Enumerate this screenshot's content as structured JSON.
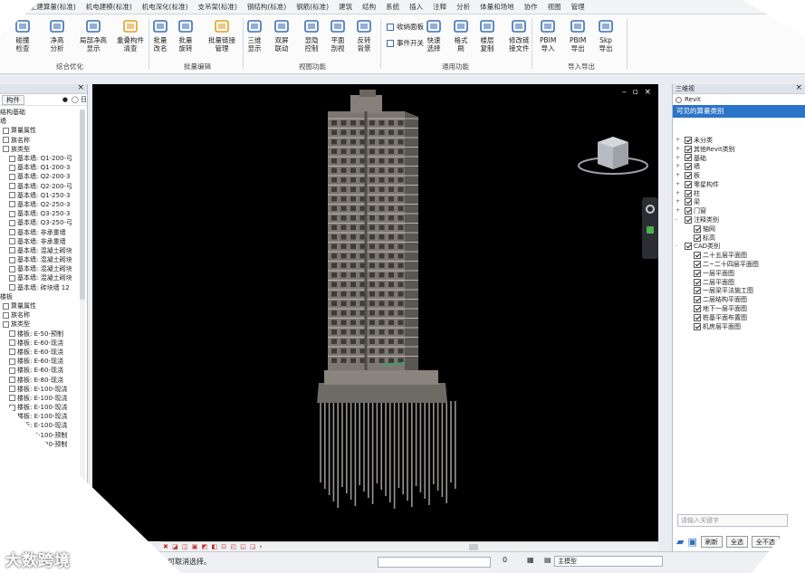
{
  "menu": [
    "结构)",
    "土建算量(标准)",
    "机电建模(标准)",
    "机电深化(标准)",
    "支吊架(标准)",
    "钢结构(标准)",
    "钢筋(标准)",
    "建筑",
    "结构",
    "系统",
    "插入",
    "注释",
    "分析",
    "体量和场地",
    "协作",
    "视图",
    "管理"
  ],
  "ribbon": {
    "b1": {
      "line1": "碰撞",
      "line2": "检查"
    },
    "b2": {
      "line1": "净高",
      "line2": "分析"
    },
    "b3": {
      "line1": "局部净高",
      "line2": "显示"
    },
    "b4": {
      "line1": "重叠构件",
      "line2": "清查"
    },
    "g1": "综合优化",
    "b5": {
      "line1": "批量",
      "line2": "改名"
    },
    "b6": {
      "line1": "批量",
      "line2": "旋转"
    },
    "b7": {
      "line1": "批量链接",
      "line2": "管理"
    },
    "g2": "批量编辑",
    "b8": {
      "line1": "三维",
      "line2": "显示"
    },
    "b9": {
      "line1": "双屏",
      "line2": "联动"
    },
    "b10": {
      "line1": "显隐",
      "line2": "控制"
    },
    "b11": {
      "line1": "平面",
      "line2": "剖视"
    },
    "b12": {
      "line1": "反转",
      "line2": "背景"
    },
    "g3": "视图功能",
    "h1": "收纳面板",
    "h2": "事件开关",
    "b13": {
      "line1": "快速",
      "line2": "选择"
    },
    "b14": {
      "line1": "格式",
      "line2": "刷"
    },
    "b15": {
      "line1": "楼层",
      "line2": "复制"
    },
    "b16": {
      "line1": "修改链",
      "line2": "接文件"
    },
    "g4": "通用功能",
    "b17": {
      "line1": "PBIM",
      "line2": "导入"
    },
    "b18": {
      "line1": "PBIM",
      "line2": "导出"
    },
    "b19": {
      "line1": "Skp",
      "line2": "导出"
    },
    "g5": "导入导出"
  },
  "left_panel": {
    "tab": "构件",
    "radio_on": "●",
    "radio_text": "◯ 日",
    "rows": [
      {
        "t": "结构基础",
        "i": 0,
        "c": false
      },
      {
        "t": "墙",
        "i": 0,
        "c": false
      },
      {
        "t": "算量属性",
        "i": 1,
        "c": true
      },
      {
        "t": "族名称",
        "i": 1,
        "c": true
      },
      {
        "t": "族类型",
        "i": 1,
        "c": true
      },
      {
        "t": "基本墙: Q1-200-弓",
        "i": 2,
        "c": true
      },
      {
        "t": "基本墙: Q1-200-3",
        "i": 2,
        "c": true
      },
      {
        "t": "基本墙: Q2-200-3",
        "i": 2,
        "c": true
      },
      {
        "t": "基本墙: Q2-200-弓",
        "i": 2,
        "c": true
      },
      {
        "t": "基本墙: Q1-250-3",
        "i": 2,
        "c": true
      },
      {
        "t": "基本墙: Q2-250-3",
        "i": 2,
        "c": true
      },
      {
        "t": "基本墙: Q3-250-3",
        "i": 2,
        "c": true
      },
      {
        "t": "基本墙: Q3-250-弓",
        "i": 2,
        "c": true
      },
      {
        "t": "基本墙: 非承重墙",
        "i": 2,
        "c": true
      },
      {
        "t": "基本墙: 非承重墙",
        "i": 2,
        "c": true
      },
      {
        "t": "基本墙: 混凝土砌块",
        "i": 2,
        "c": true
      },
      {
        "t": "基本墙: 混凝土砌块",
        "i": 2,
        "c": true
      },
      {
        "t": "基本墙: 混凝土砌块",
        "i": 2,
        "c": true
      },
      {
        "t": "基本墙: 混凝土砌块",
        "i": 2,
        "c": true
      },
      {
        "t": "基本墙: 砖块墙 12",
        "i": 2,
        "c": true
      },
      {
        "t": "楼板",
        "i": 0,
        "c": false
      },
      {
        "t": "算量属性",
        "i": 1,
        "c": true
      },
      {
        "t": "族名称",
        "i": 1,
        "c": true
      },
      {
        "t": "族类型",
        "i": 1,
        "c": true
      },
      {
        "t": "楼板: E-50-预制",
        "i": 2,
        "c": true
      },
      {
        "t": "楼板: E-60-现浇",
        "i": 2,
        "c": true
      },
      {
        "t": "楼板: E-60-现浇",
        "i": 2,
        "c": true
      },
      {
        "t": "楼板: E-60-现浇",
        "i": 2,
        "c": true
      },
      {
        "t": "楼板: E-60-现浇",
        "i": 2,
        "c": true
      },
      {
        "t": "楼板: E-80-现浇",
        "i": 2,
        "c": true
      },
      {
        "t": "楼板: E-100-现浇",
        "i": 2,
        "c": true
      },
      {
        "t": "楼板: E-100-现浇",
        "i": 2,
        "c": true
      },
      {
        "t": "楼板: E-100-现浇",
        "i": 2,
        "c": true
      },
      {
        "t": "楼板: E-100-现浇",
        "i": 2,
        "c": true
      },
      {
        "t": "楼板: E-100-现浇",
        "i": 2,
        "c": true
      },
      {
        "t": "楼板: E-100-预制",
        "i": 2,
        "c": true
      },
      {
        "t": "楼板: E-100-预制",
        "i": 2,
        "c": true
      }
    ]
  },
  "viewport": {
    "window_controls": "– ▫ ×"
  },
  "bottombar": {
    "arrow": "‹"
  },
  "status": {
    "text": "可取消选择。",
    "coord": "0",
    "label": "主模型",
    "view": "主模型"
  },
  "right_panel": {
    "header": "三维视",
    "radio_label": "Revit",
    "bar": "可见的算量类别",
    "tree": [
      {
        "t": "未分类",
        "l": 0,
        "e": "+"
      },
      {
        "t": "其他Revit类别",
        "l": 0,
        "e": "+"
      },
      {
        "t": "基础",
        "l": 0,
        "e": "+"
      },
      {
        "t": "墙",
        "l": 0,
        "e": "+"
      },
      {
        "t": "板",
        "l": 0,
        "e": "+"
      },
      {
        "t": "零星构件",
        "l": 0,
        "e": "+"
      },
      {
        "t": "柱",
        "l": 0,
        "e": "+"
      },
      {
        "t": "梁",
        "l": 0,
        "e": "+"
      },
      {
        "t": "门窗",
        "l": 0,
        "e": "+"
      },
      {
        "t": "注释类别",
        "l": 0,
        "e": "-"
      },
      {
        "t": "轴网",
        "l": 1,
        "e": ""
      },
      {
        "t": "标高",
        "l": 1,
        "e": ""
      },
      {
        "t": "CAD类别",
        "l": 0,
        "e": "-"
      },
      {
        "t": "二十五层平面图",
        "l": 1,
        "e": ""
      },
      {
        "t": "二~二十四层平面图",
        "l": 1,
        "e": ""
      },
      {
        "t": "一层平面图",
        "l": 1,
        "e": ""
      },
      {
        "t": "二层平面图",
        "l": 1,
        "e": ""
      },
      {
        "t": "一层梁平法施工图",
        "l": 1,
        "e": ""
      },
      {
        "t": "二层结构平面图",
        "l": 1,
        "e": ""
      },
      {
        "t": "地下一层平面图",
        "l": 1,
        "e": ""
      },
      {
        "t": "桩基平面布置图",
        "l": 1,
        "e": ""
      },
      {
        "t": "机房层平面图",
        "l": 1,
        "e": ""
      }
    ],
    "search_placeholder": "请输入关键字",
    "btn_refresh": "刷新",
    "btn_all": "全选",
    "btn_none": "全不选"
  },
  "watermark": "大数跨境"
}
